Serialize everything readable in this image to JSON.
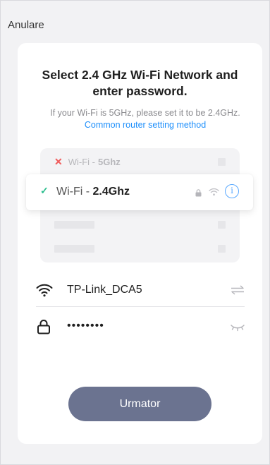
{
  "header": {
    "cancel_label": "Anulare"
  },
  "card": {
    "title": "Select 2.4 GHz Wi-Fi Network and enter password.",
    "subtitle_text": "If your Wi-Fi is 5GHz, please set it to be 2.4GHz.",
    "subtitle_link": "Common router setting method"
  },
  "illustration": {
    "row_5g": {
      "prefix": "Wi-Fi - ",
      "band": "5Ghz"
    },
    "row_24": {
      "prefix": "Wi-Fi - ",
      "band": "2.4Ghz",
      "info_glyph": "i"
    }
  },
  "form": {
    "ssid": "TP-Link_DCA5",
    "password_masked": "••••••••"
  },
  "icons": {
    "wifi": "wifi-icon",
    "lock": "lock-icon",
    "switch": "switch-network-icon",
    "eye_closed": "eye-closed-icon"
  },
  "colors": {
    "accent_link": "#1e8ffb",
    "button": "#6b7390",
    "check": "#2ebf8f",
    "cross": "#f05a5a"
  },
  "actions": {
    "next_label": "Urmator"
  }
}
